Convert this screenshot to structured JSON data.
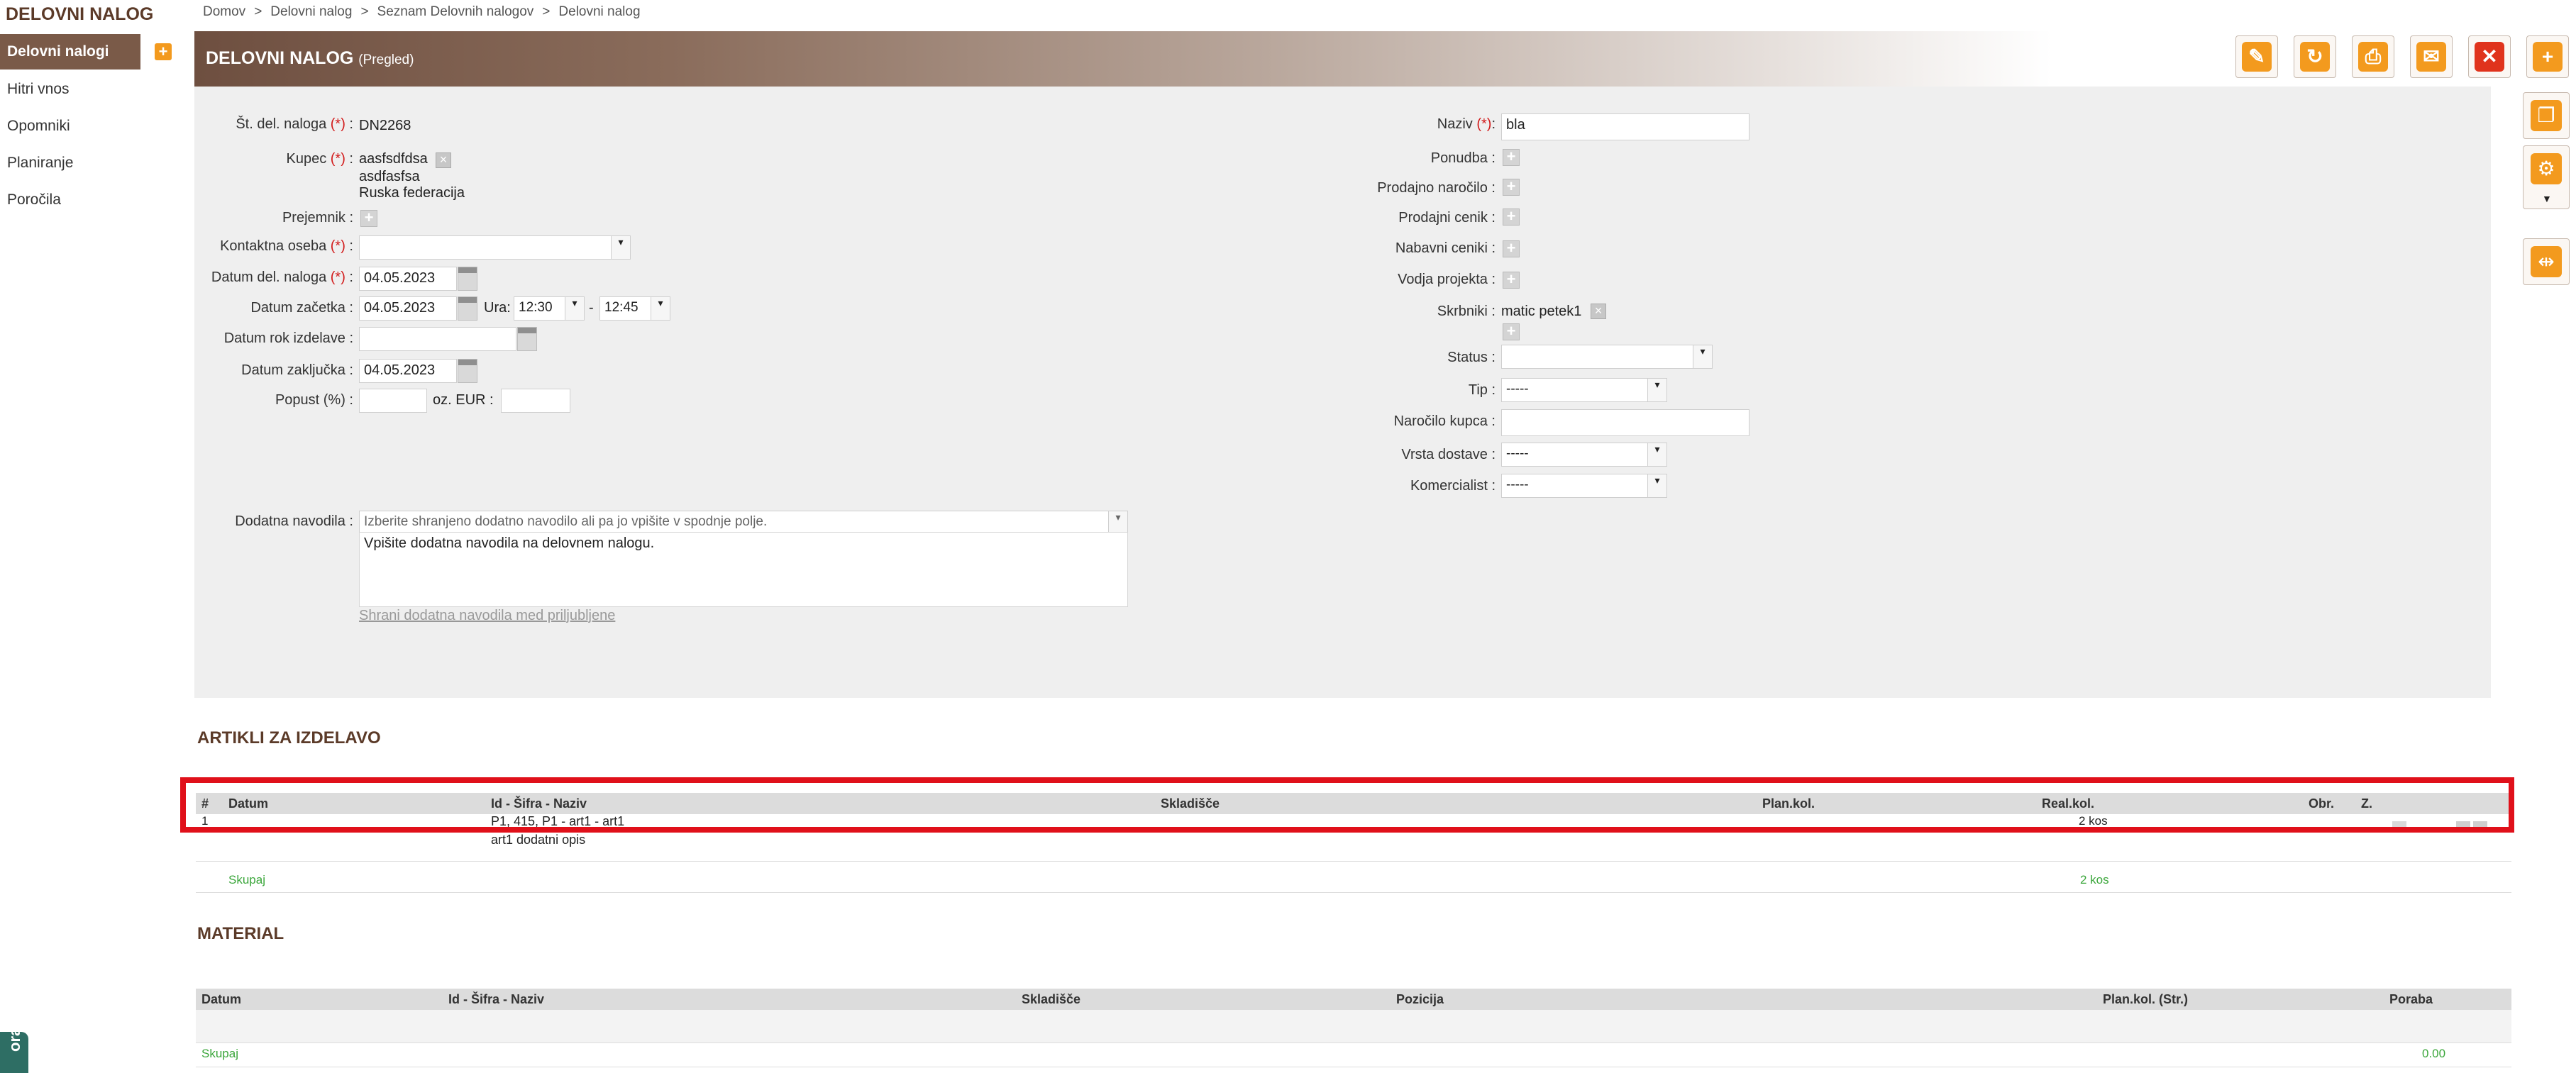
{
  "sidebar": {
    "title": "DELOVNI NALOG",
    "items": [
      {
        "label": "Delovni nalogi"
      },
      {
        "label": "Hitri vnos"
      },
      {
        "label": "Opomniki"
      },
      {
        "label": "Planiranje"
      },
      {
        "label": "Poročila"
      }
    ],
    "corner_tab": "ora"
  },
  "breadcrumb": [
    "Domov",
    "Delovni nalog",
    "Seznam Delovnih nalogov",
    "Delovni nalog"
  ],
  "header": {
    "title": "DELOVNI NALOG",
    "mode": "(Pregled)"
  },
  "toolbar": {
    "buttons": [
      {
        "icon": "pencil-icon",
        "color": "#f39a1e"
      },
      {
        "icon": "refresh-icon",
        "color": "#f39a1e"
      },
      {
        "icon": "print-icon",
        "color": "#f39a1e"
      },
      {
        "icon": "envelope-icon",
        "color": "#f39a1e"
      },
      {
        "icon": "close-icon",
        "color": "#e0331c"
      },
      {
        "icon": "plus-icon",
        "color": "#f39a1e"
      }
    ]
  },
  "form": {
    "required_mark": "(*)",
    "st_del_naloga": {
      "label": "Št. del. naloga",
      "value": "DN2268"
    },
    "kupec": {
      "label": "Kupec",
      "lines": [
        "aasfsdfdsa",
        "asdfasfsa",
        "Ruska federacija"
      ]
    },
    "prejemnik": {
      "label": "Prejemnik :"
    },
    "kontaktna_oseba": {
      "label": "Kontaktna oseba",
      "value": ""
    },
    "datum_del_naloga": {
      "label": "Datum del. naloga",
      "value": "04.05.2023"
    },
    "datum_zacetka": {
      "label": "Datum začetka :",
      "value": "04.05.2023",
      "ura_label": "Ura:",
      "time_from": "12:30",
      "dash": "-",
      "time_to": "12:45"
    },
    "datum_rok": {
      "label": "Datum rok izdelave :",
      "value": ""
    },
    "datum_zakljucka": {
      "label": "Datum zaključka :",
      "value": "04.05.2023"
    },
    "popust": {
      "label": "Popust (%) :",
      "value": "",
      "eur_label": "oz. EUR :",
      "eur_value": ""
    },
    "dodatna_navodila": {
      "label": "Dodatna navodila",
      "select_placeholder": "Izberite shranjeno dodatno navodilo ali pa jo vpišite v spodnje polje.",
      "text": "Vpišite dodatna navodila na delovnem nalogu.",
      "save_link": "Shrani dodatna navodila med priljubljene"
    },
    "naziv": {
      "label": "Naziv",
      "value": "bla"
    },
    "ponudba": {
      "label": "Ponudba :"
    },
    "prodajno_narocilo": {
      "label": "Prodajno naročilo :"
    },
    "prodajni_cenik": {
      "label": "Prodajni cenik :"
    },
    "nabavni_ceniki": {
      "label": "Nabavni ceniki :"
    },
    "vodja_projekta": {
      "label": "Vodja projekta :"
    },
    "skrbniki": {
      "label": "Skrbniki",
      "value": "matic petek1"
    },
    "status": {
      "label": "Status",
      "value": ""
    },
    "tip": {
      "label": "Tip :",
      "value": "-----"
    },
    "narocilo_kupca": {
      "label": "Naročilo kupca :",
      "value": ""
    },
    "vrsta_dostave": {
      "label": "Vrsta dostave :",
      "value": "-----"
    },
    "komercialist": {
      "label": "Komercialist :",
      "value": "-----"
    }
  },
  "articles": {
    "title": "ARTIKLI ZA IZDELAVO",
    "columns": [
      "#",
      "Datum",
      "Id - Šifra - Naziv",
      "Skladišče",
      "Plan.kol.",
      "Real.kol.",
      "Obr.",
      "Z."
    ],
    "row": {
      "num": "1",
      "name": "P1, 415, P1 - art1 - art1",
      "real": "2 kos",
      "desc": "art1 dodatni opis"
    },
    "total_label": "Skupaj",
    "total_value": "2 kos",
    "highlight_color": "#e0101a"
  },
  "material": {
    "title": "MATERIAL",
    "columns": [
      "Datum",
      "Id - Šifra - Naziv",
      "Skladišče",
      "Pozicija",
      "Plan.kol. (Str.)",
      "Poraba"
    ],
    "total_label": "Skupaj",
    "total_value": "0.00"
  }
}
